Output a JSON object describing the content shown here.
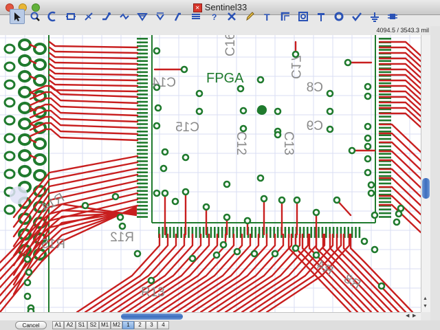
{
  "window": {
    "title": "Sentinel33"
  },
  "toolbar": {
    "tools": [
      {
        "icon": "pointer-icon",
        "active": true
      },
      {
        "icon": "zoom-icon"
      },
      {
        "icon": "arc-icon"
      },
      {
        "icon": "component-icon"
      },
      {
        "icon": "ratsnest-icon"
      },
      {
        "icon": "route-icon"
      },
      {
        "icon": "ripup-icon"
      },
      {
        "icon": "via-icon"
      },
      {
        "icon": "layer-icon"
      },
      {
        "icon": "wire-icon"
      },
      {
        "icon": "bus-icon"
      },
      {
        "icon": "query-icon"
      },
      {
        "icon": "delete-icon"
      },
      {
        "icon": "pencil-icon"
      },
      {
        "icon": "text-icon"
      },
      {
        "icon": "corner-icon"
      },
      {
        "icon": "pad-icon"
      },
      {
        "icon": "probe-icon"
      },
      {
        "icon": "ring-icon"
      },
      {
        "icon": "check-icon"
      },
      {
        "icon": "ground-icon"
      },
      {
        "icon": "chip-icon"
      }
    ]
  },
  "status": {
    "coordinates": "4094.5 / 3543.3 mil"
  },
  "board": {
    "chip_label": "FPGA",
    "labels": [
      {
        "text": "C16"
      },
      {
        "text": "C17"
      },
      {
        "text": "C14"
      },
      {
        "text": "C8"
      },
      {
        "text": "C15"
      },
      {
        "text": "C9"
      },
      {
        "text": "C12"
      },
      {
        "text": "C13"
      },
      {
        "text": "R14"
      },
      {
        "text": "R15"
      },
      {
        "text": "R12"
      },
      {
        "text": "R13"
      },
      {
        "text": "R8"
      },
      {
        "text": "R4"
      }
    ]
  },
  "bottom": {
    "cancel_label": "Cancel",
    "tabs": [
      {
        "label": "A1",
        "active": false
      },
      {
        "label": "A2",
        "active": false
      },
      {
        "label": "S1",
        "active": false
      },
      {
        "label": "S2",
        "active": false
      },
      {
        "label": "M1",
        "active": false
      },
      {
        "label": "M2",
        "active": false
      },
      {
        "label": "1",
        "active": true
      },
      {
        "label": "2",
        "active": false
      },
      {
        "label": "3",
        "active": false
      },
      {
        "label": "4",
        "active": false
      }
    ]
  },
  "colors": {
    "trace": "#c81e1e",
    "outline": "#1f7a2d",
    "silkscreen": "#8a8a8a",
    "grid": "#d9ddf3"
  }
}
